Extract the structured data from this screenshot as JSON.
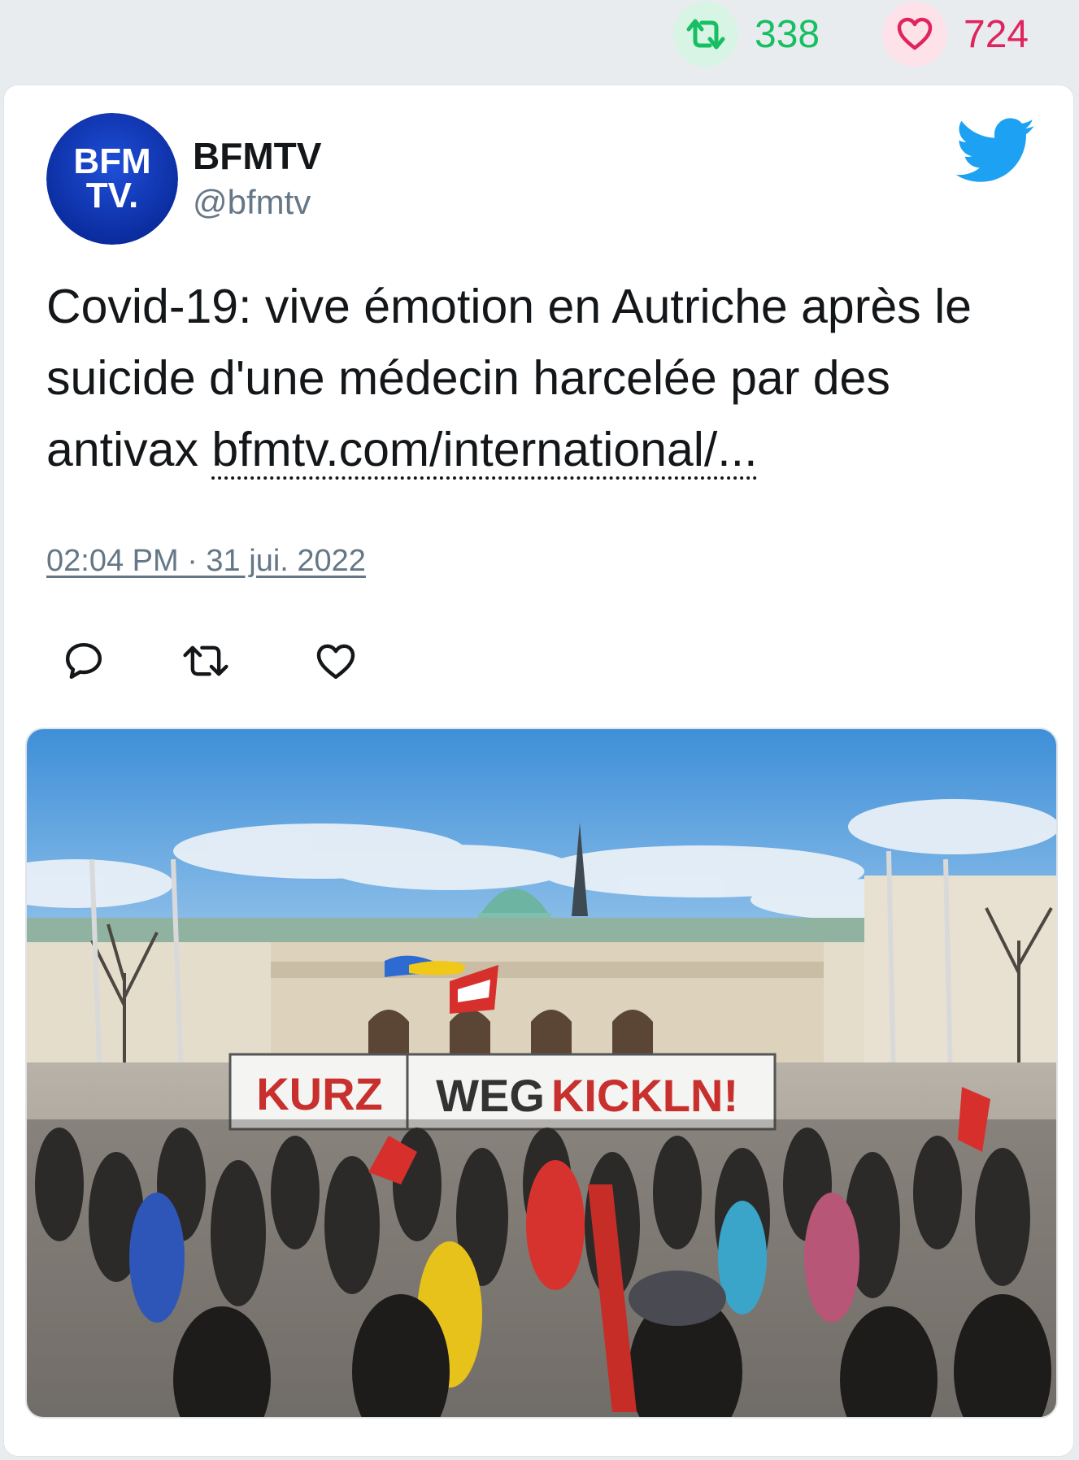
{
  "stats": {
    "retweets": "338",
    "likes": "724",
    "retweet_color": "#17bf63",
    "like_color": "#e0245e"
  },
  "tweet": {
    "avatar_text_line1": "BFM",
    "avatar_text_line2": "TV.",
    "author_name": "BFMTV",
    "author_handle": "@bfmtv",
    "text": "Covid-19: vive émotion en Autriche après le suicide d'une médecin harcelée par des antivax ",
    "link_text": "bfmtv.com/international/...",
    "timestamp": "02:04 PM · 31 jui. 2022",
    "icons": [
      "reply-icon",
      "retweet-icon",
      "like-icon",
      "twitter-bird-icon"
    ]
  },
  "media": {
    "banner_word1": "KURZ",
    "banner_word2a": "WEG",
    "banner_word2b": "KICKLN!"
  }
}
